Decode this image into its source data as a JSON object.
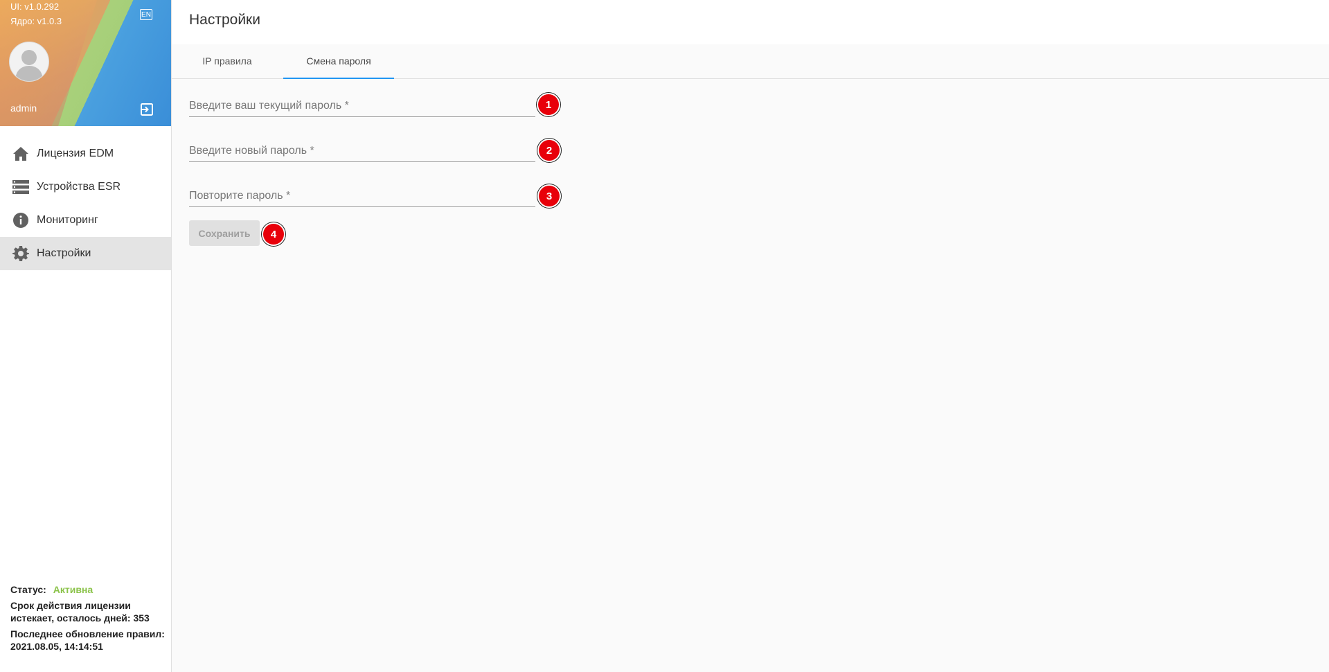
{
  "sidebar": {
    "ui_version": "UI: v1.0.292",
    "core_version": "Ядро: v1.0.3",
    "lang_label": "EN",
    "user_name": "admin",
    "items": [
      {
        "label": "Лицензия EDM",
        "icon": "home-icon"
      },
      {
        "label": "Устройства ESR",
        "icon": "list-icon"
      },
      {
        "label": "Мониторинг",
        "icon": "info-icon"
      },
      {
        "label": "Настройки",
        "icon": "gear-icon",
        "active": true
      }
    ],
    "status_label": "Статус:",
    "status_value": "Активна",
    "license_text": "Срок действия лицензии истекает, осталось дней: 353",
    "update_text": "Последнее обновление правил: 2021.08.05, 14:14:51",
    "status_color": "#8bc34a"
  },
  "header": {
    "title": "Настройки"
  },
  "tabs": [
    {
      "label": "IP правила",
      "active": false
    },
    {
      "label": "Смена пароля",
      "active": true
    }
  ],
  "form": {
    "current_password_placeholder": "Введите ваш текущий пароль *",
    "new_password_placeholder": "Введите новый пароль *",
    "repeat_password_placeholder": "Повторите пароль *",
    "save_label": "Сохранить"
  },
  "badges": [
    "1",
    "2",
    "3",
    "4"
  ],
  "colors": {
    "accent": "#2196f3",
    "badge": "#e8000a"
  }
}
